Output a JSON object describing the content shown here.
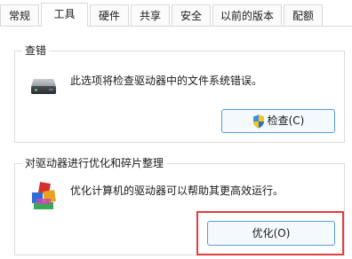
{
  "tabs": [
    {
      "label": "常规",
      "active": false
    },
    {
      "label": "工具",
      "active": true
    },
    {
      "label": "硬件",
      "active": false
    },
    {
      "label": "共享",
      "active": false
    },
    {
      "label": "安全",
      "active": false
    },
    {
      "label": "以前的版本",
      "active": false
    },
    {
      "label": "配额",
      "active": false
    }
  ],
  "check_group": {
    "title": "查错",
    "description": "此选项将检查驱动器中的文件系统错误。",
    "icon": "drive-icon",
    "button_label": "检查(C)",
    "button_icon": "uac-shield-icon"
  },
  "optimize_group": {
    "title": "对驱动器进行优化和碎片整理",
    "description": "优化计算机的驱动器可以帮助其更高效运行。",
    "icon": "defrag-icon",
    "button_label": "优化(O)"
  },
  "colors": {
    "highlight": "#e23d3d",
    "button_border": "#5b9bd5",
    "button_fill": "#f3f9fd"
  }
}
